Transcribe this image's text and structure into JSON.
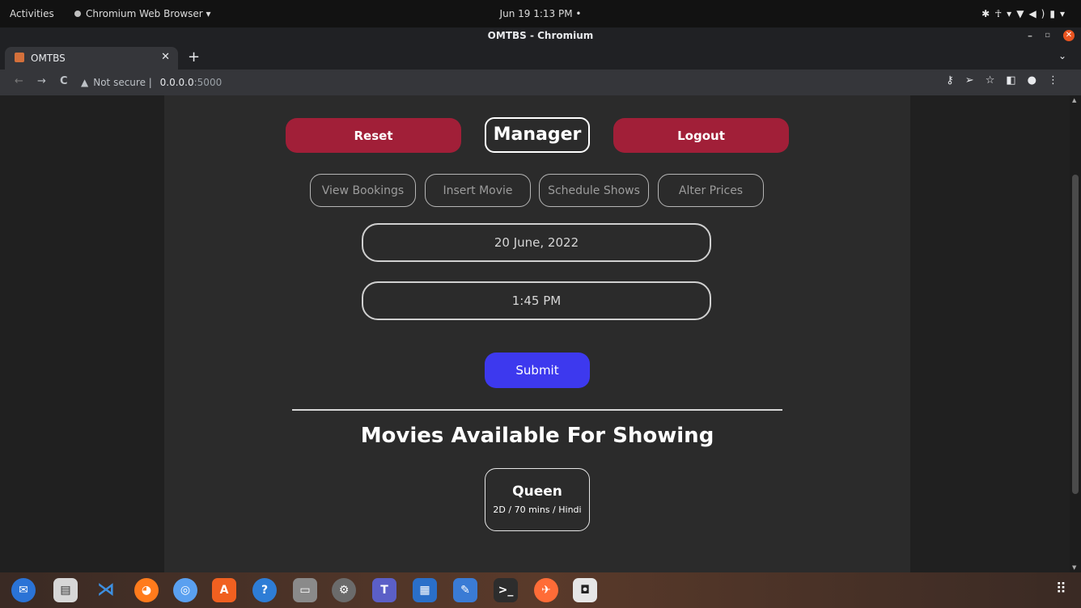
{
  "system_bar": {
    "activities": "Activities",
    "app_name": "Chromium Web Browser ▾",
    "clock": "Jun 19  1:13 PM  •"
  },
  "browser": {
    "window_title": "OMTBS - Chromium",
    "tab_title": "OMTBS",
    "security_label": "Not secure",
    "url_host": "0.0.0.0",
    "url_port": ":5000"
  },
  "page": {
    "reset_label": "Reset",
    "title": "Manager",
    "logout_label": "Logout",
    "nav": [
      "View Bookings",
      "Insert Movie",
      "Schedule Shows",
      "Alter Prices"
    ],
    "date_value": "20 June, 2022",
    "time_value": "1:45 PM",
    "submit_label": "Submit",
    "movies_heading": "Movies Available For Showing",
    "movies": [
      {
        "name": "Queen",
        "meta": "2D / 70 mins / Hindi"
      }
    ]
  },
  "colors": {
    "accent_red": "#a11f38",
    "submit_blue": "#3d39ee",
    "page_bg": "#2b2b2b"
  },
  "dock_icons": [
    "thunderbird-icon",
    "reader-icon",
    "vscode-icon",
    "firefox-icon",
    "chromium-icon",
    "app-store-icon",
    "help-icon",
    "files-icon",
    "settings-icon",
    "teams-icon",
    "document-viewer-icon",
    "text-editor-icon",
    "terminal-icon",
    "postman-icon",
    "speaker-icon"
  ]
}
